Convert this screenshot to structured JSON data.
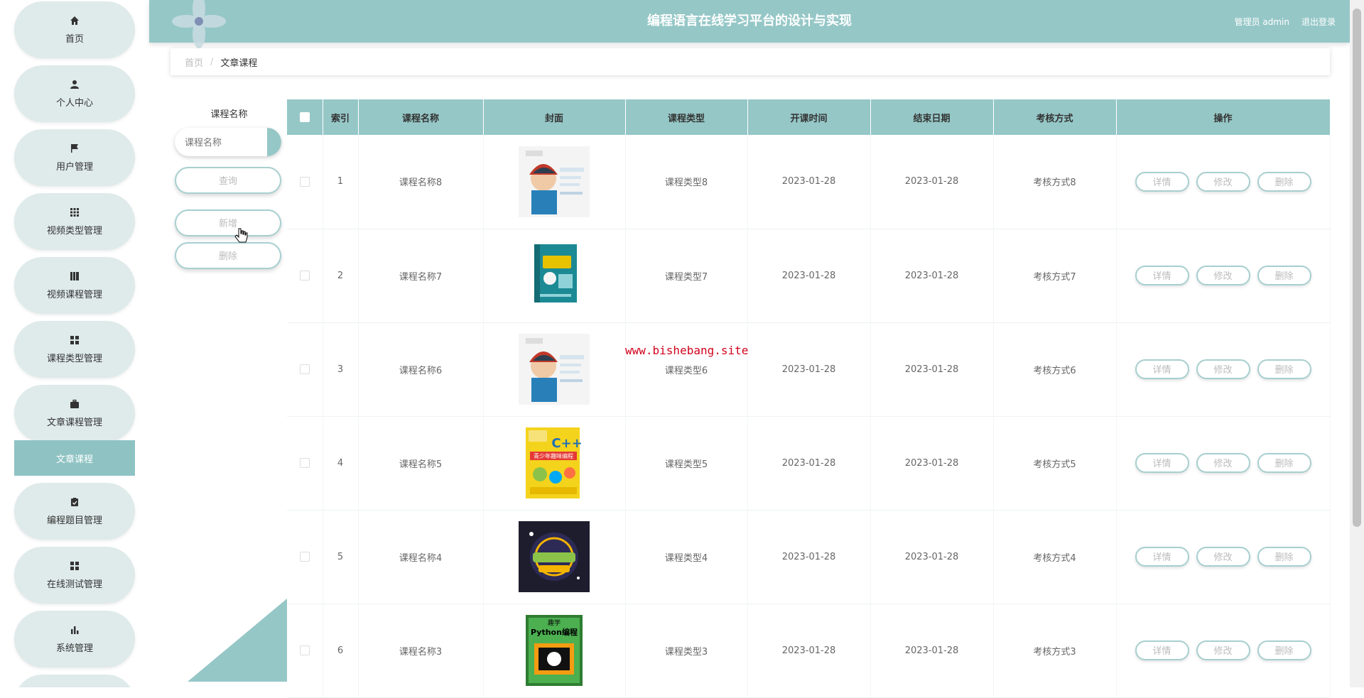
{
  "header": {
    "title": "编程语言在线学习平台的设计与实现",
    "user": "管理员 admin",
    "logout": "退出登录"
  },
  "sidebar": {
    "items": [
      {
        "label": "首页",
        "icon": "home-icon"
      },
      {
        "label": "个人中心",
        "icon": "user-icon"
      },
      {
        "label": "用户管理",
        "icon": "flag-icon"
      },
      {
        "label": "视频类型管理",
        "icon": "grid-icon"
      },
      {
        "label": "视频课程管理",
        "icon": "book-icon"
      },
      {
        "label": "课程类型管理",
        "icon": "grid4-icon"
      },
      {
        "label": "文章课程管理",
        "icon": "briefcase-icon"
      },
      {
        "label": "编程题目管理",
        "icon": "clipboard-icon"
      },
      {
        "label": "在线测试管理",
        "icon": "grid4-icon"
      },
      {
        "label": "系统管理",
        "icon": "bar-chart-icon"
      }
    ],
    "active_sub": "文章课程"
  },
  "breadcrumb": {
    "home": "首页",
    "sep": "/",
    "current": "文章课程"
  },
  "search": {
    "label": "课程名称",
    "placeholder": "课程名称",
    "query_button": "查询",
    "add_button": "新增",
    "delete_button": "删除"
  },
  "table": {
    "headers": [
      "索引",
      "课程名称",
      "封面",
      "课程类型",
      "开课时间",
      "结束日期",
      "考核方式",
      "操作"
    ],
    "rows": [
      {
        "index": "1",
        "name": "课程名称8",
        "type": "课程类型8",
        "start": "2023-01-28",
        "end": "2023-01-28",
        "exam": "考核方式8",
        "cover": "cover-kid"
      },
      {
        "index": "2",
        "name": "课程名称7",
        "type": "课程类型7",
        "start": "2023-01-28",
        "end": "2023-01-28",
        "exam": "考核方式7",
        "cover": "cover-teal-book"
      },
      {
        "index": "3",
        "name": "课程名称6",
        "type": "课程类型6",
        "start": "2023-01-28",
        "end": "2023-01-28",
        "exam": "考核方式6",
        "cover": "cover-kid"
      },
      {
        "index": "4",
        "name": "课程名称5",
        "type": "课程类型5",
        "start": "2023-01-28",
        "end": "2023-01-28",
        "exam": "考核方式5",
        "cover": "cover-cpp"
      },
      {
        "index": "5",
        "name": "课程名称4",
        "type": "课程类型4",
        "start": "2023-01-28",
        "end": "2023-01-28",
        "exam": "考核方式4",
        "cover": "cover-dark"
      },
      {
        "index": "6",
        "name": "课程名称3",
        "type": "课程类型3",
        "start": "2023-01-28",
        "end": "2023-01-28",
        "exam": "考核方式3",
        "cover": "cover-python"
      }
    ],
    "actions": {
      "detail": "详情",
      "edit": "修改",
      "delete": "删除"
    }
  },
  "watermark": "www.bishebang.site",
  "cover_texts": {
    "cpp_letter": "C++",
    "cpp_title": "青少年趣味编程",
    "python_top": "趣学",
    "python_title": "Python编程"
  },
  "colors": {
    "accent": "#96c7c7",
    "sidebar_item_bg": "#dfeaea",
    "active_sub_bg": "#8fc3c3",
    "watermark": "#d0021b"
  }
}
